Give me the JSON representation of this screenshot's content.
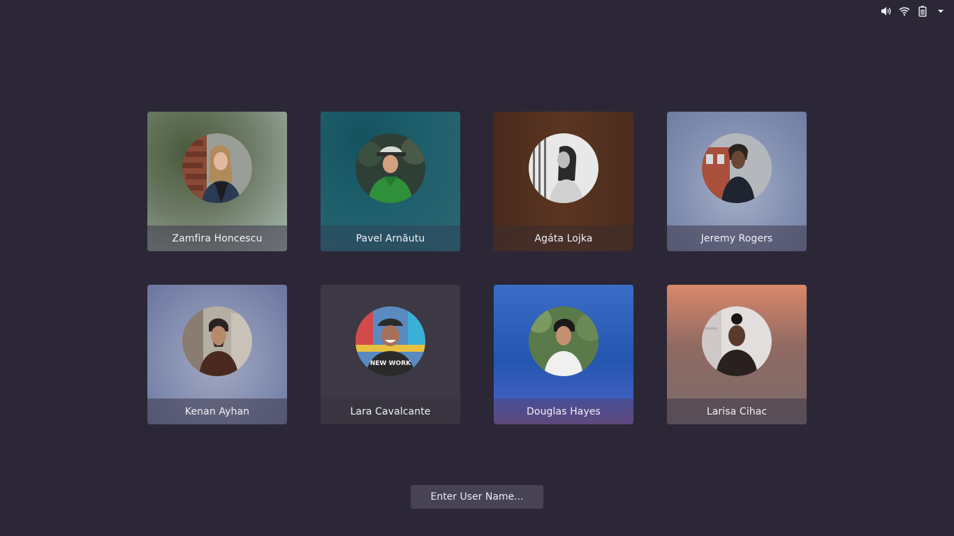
{
  "indicators": [
    {
      "name": "volume-icon",
      "label": "Volume"
    },
    {
      "name": "wifi-icon",
      "label": "Wi-Fi"
    },
    {
      "name": "battery-icon",
      "label": "Battery"
    },
    {
      "name": "chevron-down-icon",
      "label": "Menu"
    }
  ],
  "users": [
    {
      "name": "Zamfira Honcescu",
      "bg": "#7a8a72",
      "accent": "#3a2a22"
    },
    {
      "name": "Pavel Arnăutu",
      "bg": "#1f5f6c",
      "accent": "#2f8f3a"
    },
    {
      "name": "Agáta Lojka",
      "bg": "#5a3520",
      "accent": "#9a9a9a"
    },
    {
      "name": "Jeremy Rogers",
      "bg": "#8793b4",
      "accent": "#1e2430"
    },
    {
      "name": "Kenan Ayhan",
      "bg": "#8690b2",
      "accent": "#4a2a20"
    },
    {
      "name": "Lara Cavalcante",
      "bg": "#3c3844",
      "accent": "#2a2a2a"
    },
    {
      "name": "Douglas Hayes",
      "bg": "#2456b0",
      "accent": "#f0f0f0"
    },
    {
      "name": "Larisa Cihac",
      "bg": "#8f6a62",
      "accent": "#2a2020"
    }
  ],
  "login": {
    "enter_user_label": "Enter User Name..."
  }
}
